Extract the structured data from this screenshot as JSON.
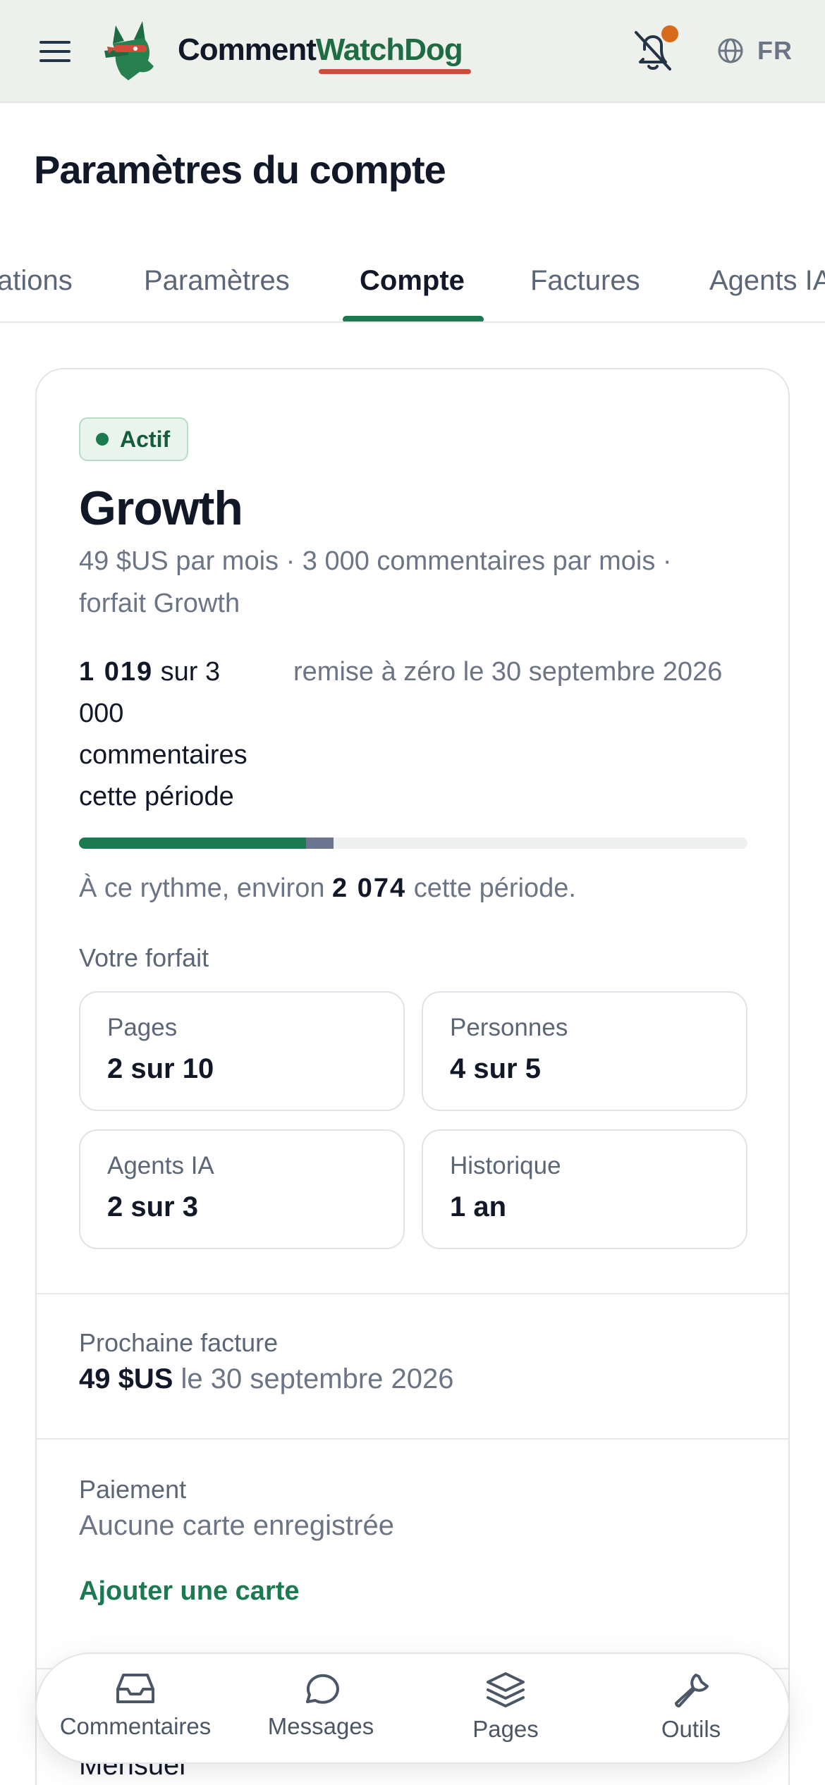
{
  "header": {
    "brand_part1": "Comment",
    "brand_part2": "WatchDog",
    "language": "FR",
    "icons": [
      "menu-icon",
      "bell-off-icon",
      "globe-icon"
    ],
    "notification_dot_color": "#d86a1c"
  },
  "page": {
    "title": "Paramètres du compte"
  },
  "tabs": [
    {
      "label": "ations"
    },
    {
      "label": "Paramètres"
    },
    {
      "label": "Compte",
      "active": true
    },
    {
      "label": "Factures"
    },
    {
      "label": "Agents IA"
    }
  ],
  "plan": {
    "status": "Actif",
    "name": "Growth",
    "description": "49 $US par mois · 3 000 commentaires par mois · forfait Growth",
    "usage_count": "1 019",
    "usage_rest": "sur 3 000 commentaires cette période",
    "reset_text": "remise à zéro le 30 septembre 2026",
    "usage_fraction": 0.3397,
    "projected_fraction": 0.3803,
    "forecast_prefix": "À ce rythme, environ",
    "forecast_value": "2 074",
    "forecast_suffix": "cette période.",
    "section_label": "Votre forfait",
    "stats": [
      {
        "label": "Pages",
        "value": "2 sur 10"
      },
      {
        "label": "Personnes",
        "value": "4 sur 5"
      },
      {
        "label": "Agents IA",
        "value": "2 sur 3"
      },
      {
        "label": "Historique",
        "value": "1 an"
      }
    ]
  },
  "billing": {
    "next_invoice_label": "Prochaine facture",
    "next_invoice_amount": "49 $US",
    "next_invoice_date": "le 30 septembre 2026",
    "payment_label": "Paiement",
    "payment_value": "Aucune carte enregistrée",
    "add_card_label": "Ajouter une carte",
    "cut_off_text": "Mensuel"
  },
  "nav": [
    {
      "label": "Commentaires",
      "icon": "inbox-icon"
    },
    {
      "label": "Messages",
      "icon": "message-circle-icon"
    },
    {
      "label": "Pages",
      "icon": "layers-icon"
    },
    {
      "label": "Outils",
      "icon": "wrench-icon"
    }
  ],
  "colors": {
    "accent": "#1b7a4f",
    "header_bg": "#eef0ec",
    "brand_underline": "#d14b3b"
  }
}
